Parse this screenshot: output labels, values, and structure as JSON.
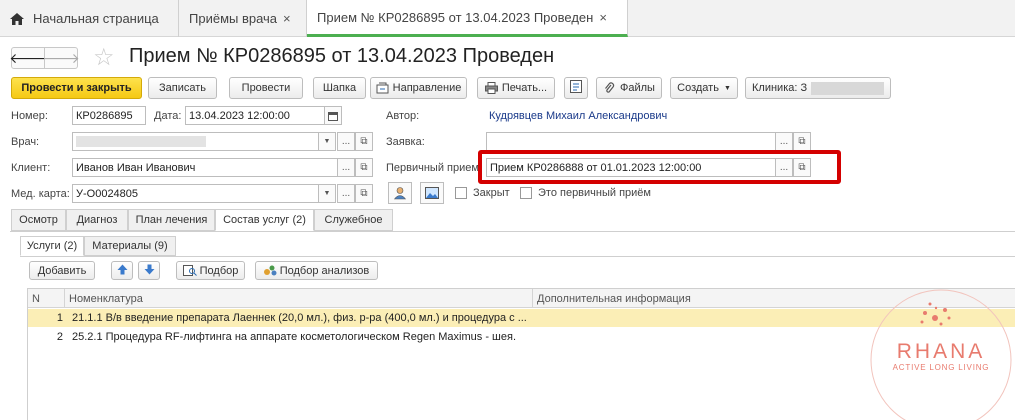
{
  "tabs": {
    "home": "Начальная страница",
    "doctor": "Приёмы врача",
    "current": "Прием № КР0286895 от 13.04.2023 Проведен"
  },
  "title": "Прием № КР0286895 от 13.04.2023 Проведен",
  "toolbar": {
    "post_close": "Провести и закрыть",
    "save": "Записать",
    "post": "Провести",
    "header": "Шапка",
    "referral": "Направление",
    "print": "Печать...",
    "files": "Файлы",
    "create": "Создать",
    "clinic": "Клиника: З"
  },
  "form": {
    "number_label": "Номер:",
    "number_value": "КР0286895",
    "date_label": "Дата:",
    "date_value": "13.04.2023 12:00:00",
    "author_label": "Автор:",
    "author_value": "Кудрявцев Михаил Александрович",
    "doctor_label": "Врач:",
    "request_label": "Заявка:",
    "client_label": "Клиент:",
    "client_value": "Иванов Иван Иванович",
    "primary_label": "Первичный прием",
    "primary_value": "Прием КР0286888 от 01.01.2023 12:00:00",
    "card_label": "Мед. карта:",
    "card_value": "У-О0024805",
    "closed_label": "Закрыт",
    "first_visit_label": "Это первичный приём"
  },
  "inner_tabs": [
    "Осмотр",
    "Диагноз",
    "План лечения",
    "Состав услуг (2)",
    "Служебное"
  ],
  "sub_tabs": [
    "Услуги (2)",
    "Материалы (9)"
  ],
  "sub_toolbar": {
    "add": "Добавить",
    "pick": "Подбор",
    "pick_analyses": "Подбор анализов"
  },
  "table": {
    "columns": [
      "N",
      "Номенклатура",
      "Дополнительная информация"
    ],
    "rows": [
      {
        "n": "1",
        "name": "21.1.1 В/в введение препарата Лаеннек (20,0 мл.), физ. р-ра (400,0 мл.) и процедура с ...",
        "info": ""
      },
      {
        "n": "2",
        "name": "25.2.1 Процедура RF-лифтинга на  аппарате  косметологическом  Regen Maximus - шея.",
        "info": ""
      }
    ]
  },
  "watermark": {
    "brand": "RHANA",
    "tagline": "ACTIVE LONG LIVING",
    "color": "#e87b6e"
  },
  "colors": {
    "primary_button": "#f5c914",
    "highlight_border": "#d40000",
    "active_tab_underline": "#4caf50",
    "selected_row": "#fbeeb6"
  }
}
